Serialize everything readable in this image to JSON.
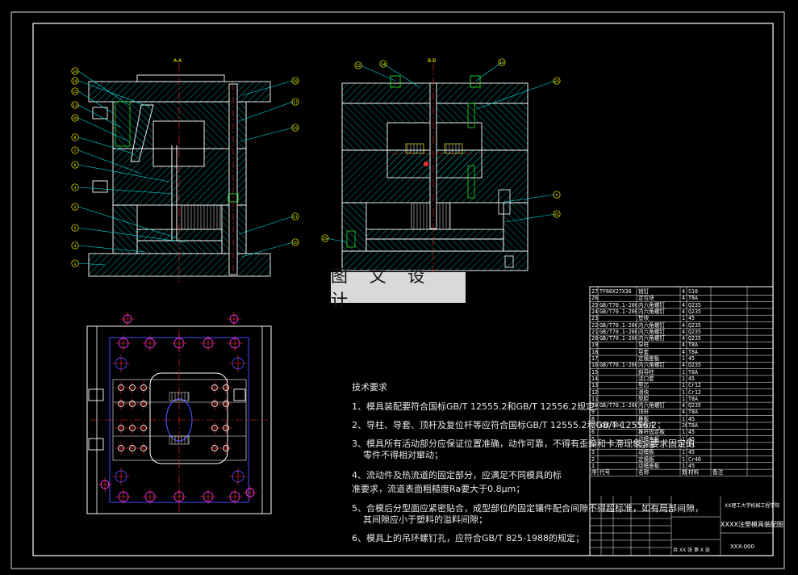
{
  "watermark": "图 文 设 计",
  "views": {
    "section_aa": "A-A",
    "section_bb": "B-B"
  },
  "left_balloons": [
    "24",
    "16",
    "15",
    "12",
    "20",
    "8",
    "7",
    "6",
    "3",
    "2",
    "5",
    "4",
    "1"
  ],
  "left_right_balloons": [
    "18",
    "17",
    "19",
    "11",
    "10"
  ],
  "bb_balloons": [
    "22",
    "14",
    "13",
    "23",
    "9",
    "21",
    "25"
  ],
  "notes": {
    "heading": "技术要求",
    "items": [
      "1、模具装配要符合国标GB/T 12555.2和GB/T 12556.2规定;",
      "2、导柱、导套、顶杆及复位杆等应符合国标GB/T 12555.2和GB/T 12556.2；",
      "3、模具所有活动部分应保证位置准确，动作可靠，不得有歪斜和卡滞现象；要求固定的",
      "零件不得相对窜动；",
      "4、流动件及热流道的固定部分，应满足不同模具的标准要求，流道表面粗糙度Ra要大于0.8μm；",
      "5、合模后分型面应紧密贴合，成型部位的固定镶件配合间隙不得超标准，如有局部间隙，",
      "其间隙应小于塑料的溢料间隙；",
      "6、模具上的吊环螺钉孔，应符合GB/T 825-1988的规定；"
    ]
  },
  "bom": [
    {
      "no": "27",
      "code": "TF60X27X36",
      "name": "销钉",
      "qty": "4",
      "mat": "S10",
      "note": ""
    },
    {
      "no": "26",
      "code": "",
      "name": "定位块",
      "qty": "4",
      "mat": "T8A",
      "note": ""
    },
    {
      "no": "25",
      "code": "GB/T70.1-2000",
      "name": "内六角螺钉",
      "qty": "4",
      "mat": "Q235",
      "note": ""
    },
    {
      "no": "24",
      "code": "GB/T70.1-2000",
      "name": "内六角螺钉",
      "qty": "4",
      "mat": "Q235",
      "note": ""
    },
    {
      "no": "23",
      "code": "",
      "name": "垫块",
      "qty": "1",
      "mat": "45",
      "note": ""
    },
    {
      "no": "22",
      "code": "GB/T70.1-2000",
      "name": "内六角螺钉",
      "qty": "4",
      "mat": "Q235",
      "note": ""
    },
    {
      "no": "21",
      "code": "GB/T70.1-2000",
      "name": "内六角螺钉",
      "qty": "4",
      "mat": "Q235",
      "note": ""
    },
    {
      "no": "20",
      "code": "GB/T70.1-2000",
      "name": "内六角螺钉",
      "qty": "4",
      "mat": "Q235",
      "note": ""
    },
    {
      "no": "19",
      "code": "",
      "name": "导柱",
      "qty": "4",
      "mat": "T8A",
      "note": ""
    },
    {
      "no": "18",
      "code": "",
      "name": "导套",
      "qty": "4",
      "mat": "T8A",
      "note": ""
    },
    {
      "no": "17",
      "code": "",
      "name": "定模座板",
      "qty": "1",
      "mat": "45",
      "note": ""
    },
    {
      "no": "16",
      "code": "GB/T70.1-2000",
      "name": "内六角螺钉",
      "qty": "4",
      "mat": "Q235",
      "note": ""
    },
    {
      "no": "15",
      "code": "",
      "name": "斜导柱",
      "qty": "1",
      "mat": "T8A",
      "note": ""
    },
    {
      "no": "14",
      "code": "",
      "name": "浇口套",
      "qty": "1",
      "mat": "45",
      "note": ""
    },
    {
      "no": "13",
      "code": "",
      "name": "型芯",
      "qty": "1",
      "mat": "Cr12",
      "note": ""
    },
    {
      "no": "12",
      "code": "",
      "name": "滑块",
      "qty": "1",
      "mat": "Cr12",
      "note": ""
    },
    {
      "no": "11",
      "code": "",
      "name": "型腔",
      "qty": "1",
      "mat": "T8A",
      "note": ""
    },
    {
      "no": "10",
      "code": "GB/T70.1-2000",
      "name": "内六角螺钉",
      "qty": "4",
      "mat": "Q235",
      "note": ""
    },
    {
      "no": "9",
      "code": "",
      "name": "顶杆",
      "qty": "4",
      "mat": "T8A",
      "note": ""
    },
    {
      "no": "8",
      "code": "",
      "name": "推板",
      "qty": "1",
      "mat": "45",
      "note": ""
    },
    {
      "no": "7",
      "code": "XXX-004",
      "name": "复位杆",
      "qty": "20",
      "mat": "T8A",
      "note": ""
    },
    {
      "no": "6",
      "code": "",
      "name": "推杆固定板",
      "qty": "1",
      "mat": "45",
      "note": ""
    },
    {
      "no": "5",
      "code": "",
      "name": "动模座板",
      "qty": "1",
      "mat": "45",
      "note": ""
    },
    {
      "no": "4",
      "code": "",
      "name": "支撑板",
      "qty": "2",
      "mat": "45",
      "note": ""
    },
    {
      "no": "3",
      "code": "",
      "name": "动模板",
      "qty": "1",
      "mat": "45",
      "note": ""
    },
    {
      "no": "2",
      "code": "",
      "name": "定模板",
      "qty": "1",
      "mat": "Cr40",
      "note": ""
    },
    {
      "no": "1",
      "code": "",
      "name": "动模座板",
      "qty": "1",
      "mat": "45",
      "note": ""
    }
  ],
  "bom_header": {
    "no": "序号",
    "code": "代号",
    "name": "名称",
    "qty": "数量",
    "mat": "材料",
    "note": "备注"
  },
  "title_block": {
    "school": "XX理工大学机械工程学院",
    "drawing_name": "XXXX注塑模具装配图",
    "drawing_no": "XXX-000",
    "sheet": "共 XX 张 第 X 张"
  },
  "colors": {
    "background": "#000000",
    "frame": "#ffffff",
    "hatch": "#00b2b2",
    "balloon": "#ffff00",
    "leader": "#00ffff",
    "centerline": "#ff2a2a",
    "plan_lines": "#4a4aff",
    "plan_holes": "#ff33ff",
    "green_part": "#22dd22"
  }
}
